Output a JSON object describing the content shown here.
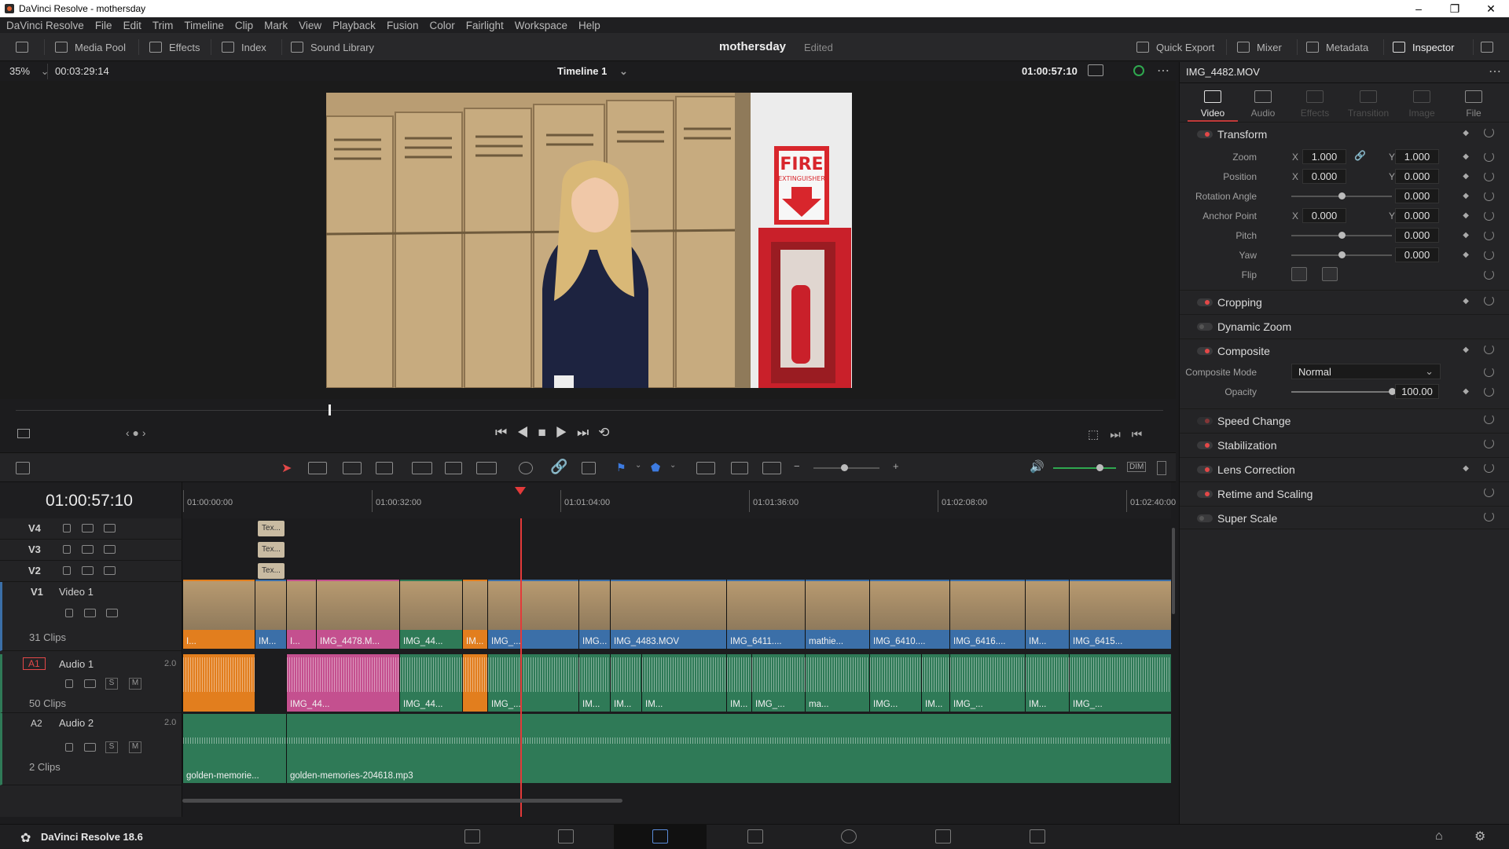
{
  "window": {
    "title": "DaVinci Resolve - mothersday",
    "min": "–",
    "max": "❐",
    "close": "✕"
  },
  "menu": [
    "DaVinci Resolve",
    "File",
    "Edit",
    "Trim",
    "Timeline",
    "Clip",
    "Mark",
    "View",
    "Playback",
    "Fusion",
    "Color",
    "Fairlight",
    "Workspace",
    "Help"
  ],
  "toolbar": {
    "media_pool": "Media Pool",
    "effects": "Effects",
    "index": "Index",
    "sound_library": "Sound Library",
    "project": "mothersday",
    "project_status": "Edited",
    "quick_export": "Quick Export",
    "mixer": "Mixer",
    "metadata": "Metadata",
    "inspector": "Inspector"
  },
  "viewer": {
    "zoom": "35%",
    "duration": "00:03:29:14",
    "timeline_name": "Timeline 1",
    "timecode": "01:00:57:10"
  },
  "frame": {
    "sign_title": "FIRE",
    "sign_sub": "EXTINGUISHER"
  },
  "inspector": {
    "clip_name": "IMG_4482.MOV",
    "tabs": [
      "Video",
      "Audio",
      "Effects",
      "Transition",
      "Image",
      "File"
    ],
    "transform": {
      "title": "Transform",
      "zoom_label": "Zoom",
      "zoom_x": "1.000",
      "zoom_y": "1.000",
      "position_label": "Position",
      "position_x": "0.000",
      "position_y": "0.000",
      "rotation_label": "Rotation Angle",
      "rotation": "0.000",
      "anchor_label": "Anchor Point",
      "anchor_x": "0.000",
      "anchor_y": "0.000",
      "pitch_label": "Pitch",
      "pitch": "0.000",
      "yaw_label": "Yaw",
      "yaw": "0.000",
      "flip_label": "Flip",
      "x": "X",
      "y": "Y"
    },
    "cropping": "Cropping",
    "dynamic_zoom": "Dynamic Zoom",
    "composite": {
      "title": "Composite",
      "mode_label": "Composite Mode",
      "mode": "Normal",
      "opacity_label": "Opacity",
      "opacity": "100.00"
    },
    "speed_change": "Speed Change",
    "stabilization": "Stabilization",
    "lens_correction": "Lens Correction",
    "retime": "Retime and Scaling",
    "super_scale": "Super Scale"
  },
  "timeline": {
    "timecode": "01:00:57:10",
    "ruler": [
      "01:00:00:00",
      "01:00:32:00",
      "01:01:04:00",
      "01:01:36:00",
      "01:02:08:00",
      "01:02:40:00"
    ],
    "dim_label": "DIM",
    "tracks": {
      "v4": "V4",
      "v3": "V3",
      "v2": "V2",
      "v1": "V1",
      "v1_name": "Video 1",
      "v1_clips": "31 Clips",
      "a1": "A1",
      "a1_name": "Audio 1",
      "a1_ch": "2.0",
      "a1_clips": "50 Clips",
      "a2": "A2",
      "a2_name": "Audio 2",
      "a2_ch": "2.0",
      "a2_clips": "2 Clips",
      "s": "S",
      "m": "M"
    },
    "title_clip": "Tex...",
    "video_clips": [
      "I...",
      "IM...",
      "I...",
      "IMG_4478.M...",
      "IMG_44...",
      "IM...",
      "IMG_...",
      "IMG...",
      "IMG_4483.MOV",
      "IMG_6411....",
      "mathie...",
      "IMG_6410....",
      "IMG_6416....",
      "IM...",
      "IMG_6415..."
    ],
    "audio_clips": [
      "IMG_44...",
      "IMG_44...",
      "IMG_...",
      "IM...",
      "IM...",
      "IM...",
      "IM...",
      "IMG_...",
      "ma...",
      "IMG...",
      "IM...",
      "IMG_...",
      "IM...",
      "IMG_..."
    ],
    "audio2_clips": [
      "golden-memorie...",
      "golden-memories-204618.mp3"
    ]
  },
  "footer": {
    "app_version": "DaVinci Resolve 18.6"
  },
  "colors": {
    "accent": "#e34848",
    "video_clip": "#3b6fa8",
    "audio_clip": "#2f7a57",
    "pink_clip": "#c4508f",
    "orange_clip": "#e27e1e",
    "playhead": "#e33a3a"
  }
}
